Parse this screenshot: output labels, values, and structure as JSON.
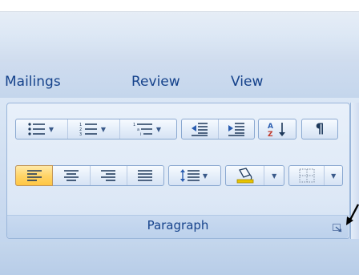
{
  "tabs": [
    {
      "label": "Mailings"
    },
    {
      "label": "Review"
    },
    {
      "label": "View"
    }
  ],
  "group": {
    "label": "Paragraph"
  },
  "icons": {
    "bullets": "bullets-icon",
    "numbering": "numbering-icon",
    "multilevel": "multilevel-list-icon",
    "decrease_indent": "decrease-indent-icon",
    "increase_indent": "increase-indent-icon",
    "sort": "sort-icon",
    "show_marks": "pilcrow-icon",
    "align_left": "align-left-icon",
    "center": "align-center-icon",
    "align_right": "align-right-icon",
    "justify": "justify-icon",
    "line_spacing": "line-spacing-icon",
    "shading": "shading-icon",
    "borders": "borders-icon",
    "launcher": "dialog-launcher-icon"
  },
  "colors": {
    "tab_text": "#15428b",
    "active_button": "#ffd56a",
    "shading_bar": "#e8c400"
  }
}
